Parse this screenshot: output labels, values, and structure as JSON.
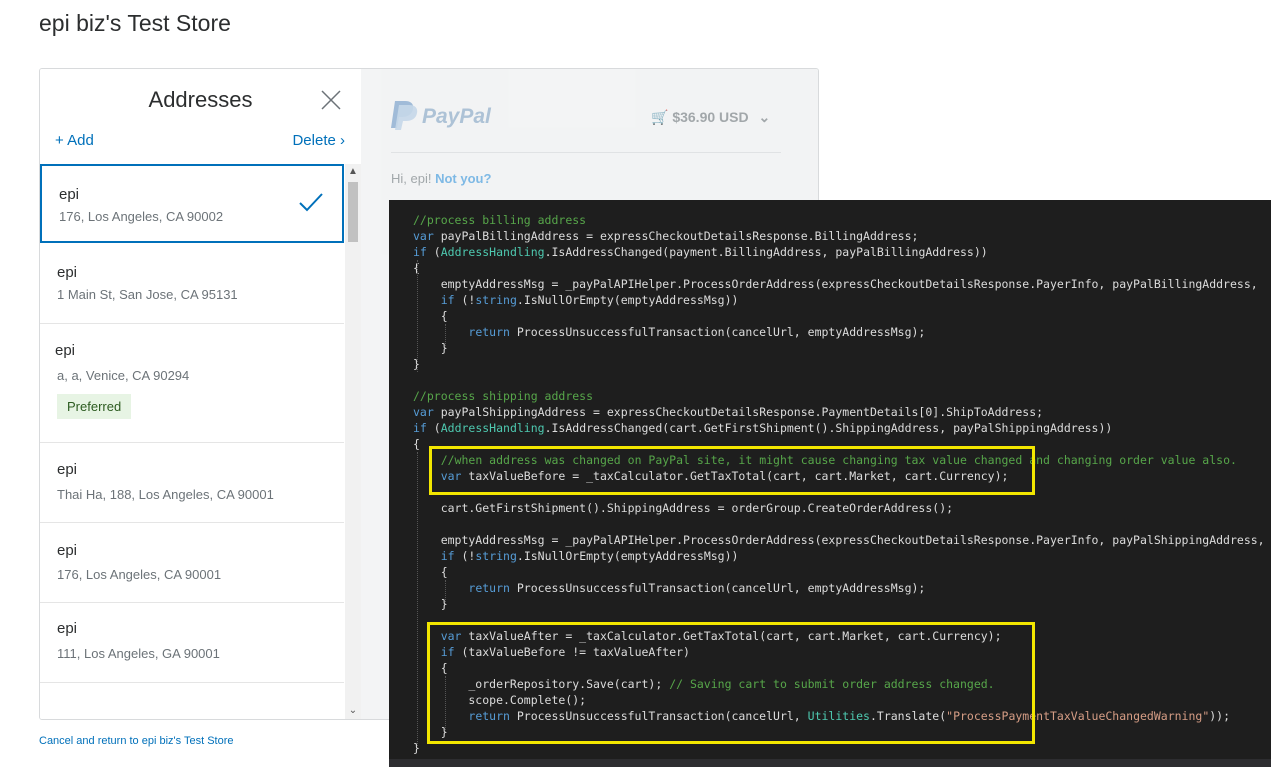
{
  "store": {
    "title": "epi biz's Test Store"
  },
  "addresses": {
    "title": "Addresses",
    "add_label": "Add",
    "delete_label": "Delete",
    "items": [
      {
        "name": "epi",
        "address": "176, Los Angeles, CA 90002",
        "selected": true
      },
      {
        "name": "epi",
        "address": "1 Main St, San Jose, CA 95131"
      },
      {
        "name": "epi",
        "address": "a, a, Venice, CA 90294",
        "badge": "Preferred"
      },
      {
        "name": "epi",
        "address": "Thai Ha, 188, Los Angeles, CA 90001"
      },
      {
        "name": "epi",
        "address": "176, Los Angeles, CA 90001"
      },
      {
        "name": "epi",
        "address": "111, Los Angeles, GA 90001"
      }
    ]
  },
  "paypal": {
    "logo": "PayPal",
    "cart_total": "$36.90 USD",
    "greeting": "Hi, epi!",
    "not_you": "Not you?"
  },
  "footer": {
    "cancel_link": "Cancel and return to epi biz's Test Store"
  },
  "colors": {
    "accent": "#0070ba",
    "highlight": "#f2e600",
    "code_bg": "#1e1e1e"
  },
  "code": {
    "lines": [
      "//process billing address",
      "var payPalBillingAddress = expressCheckoutDetailsResponse.BillingAddress;",
      "if (AddressHandling.IsAddressChanged(payment.BillingAddress, payPalBillingAddress))",
      "{",
      "    emptyAddressMsg = _payPalAPIHelper.ProcessOrderAddress(expressCheckoutDetailsResponse.PayerInfo, payPalBillingAddress,",
      "    if (!string.IsNullOrEmpty(emptyAddressMsg))",
      "    {",
      "        return ProcessUnsuccessfulTransaction(cancelUrl, emptyAddressMsg);",
      "    }",
      "}",
      "",
      "//process shipping address",
      "var payPalShippingAddress = expressCheckoutDetailsResponse.PaymentDetails[0].ShipToAddress;",
      "if (AddressHandling.IsAddressChanged(cart.GetFirstShipment().ShippingAddress, payPalShippingAddress))",
      "{",
      "    //when address was changed on PayPal site, it might cause changing tax value changed and changing order value also.",
      "    var taxValueBefore = _taxCalculator.GetTaxTotal(cart, cart.Market, cart.Currency);",
      "",
      "    cart.GetFirstShipment().ShippingAddress = orderGroup.CreateOrderAddress();",
      "",
      "    emptyAddressMsg = _payPalAPIHelper.ProcessOrderAddress(expressCheckoutDetailsResponse.PayerInfo, payPalShippingAddress,",
      "    if (!string.IsNullOrEmpty(emptyAddressMsg))",
      "    {",
      "        return ProcessUnsuccessfulTransaction(cancelUrl, emptyAddressMsg);",
      "    }",
      "",
      "    var taxValueAfter = _taxCalculator.GetTaxTotal(cart, cart.Market, cart.Currency);",
      "    if (taxValueBefore != taxValueAfter)",
      "    {",
      "        _orderRepository.Save(cart); // Saving cart to submit order address changed.",
      "        scope.Complete();",
      "        return ProcessUnsuccessfulTransaction(cancelUrl, Utilities.Translate(\"ProcessPaymentTaxValueChangedWarning\"));",
      "    }",
      "}"
    ]
  }
}
